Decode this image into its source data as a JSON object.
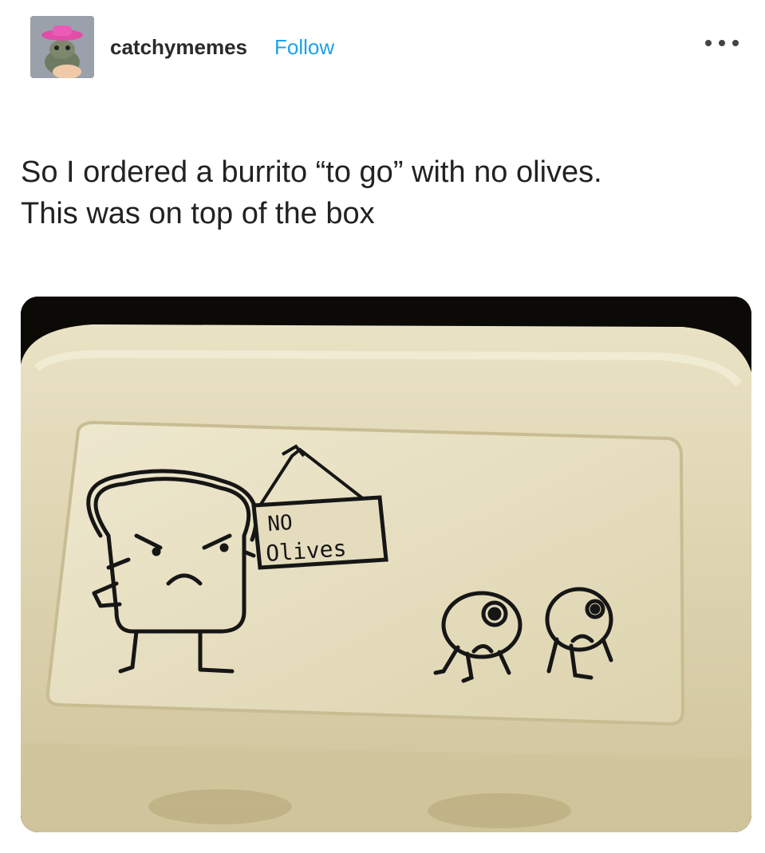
{
  "post": {
    "username": "catchymemes",
    "follow_label": "Follow",
    "more_icon": "more-horizontal-icon",
    "text_line1": "So I ordered a burrito “to go” with no olives.",
    "text_line2": "This was on top of the box"
  },
  "photo": {
    "sign_line1": "NO",
    "sign_line2": "Olives"
  },
  "colors": {
    "follow": "#1da1e6",
    "box": "#ddd3b0",
    "background": "#ffffff"
  }
}
